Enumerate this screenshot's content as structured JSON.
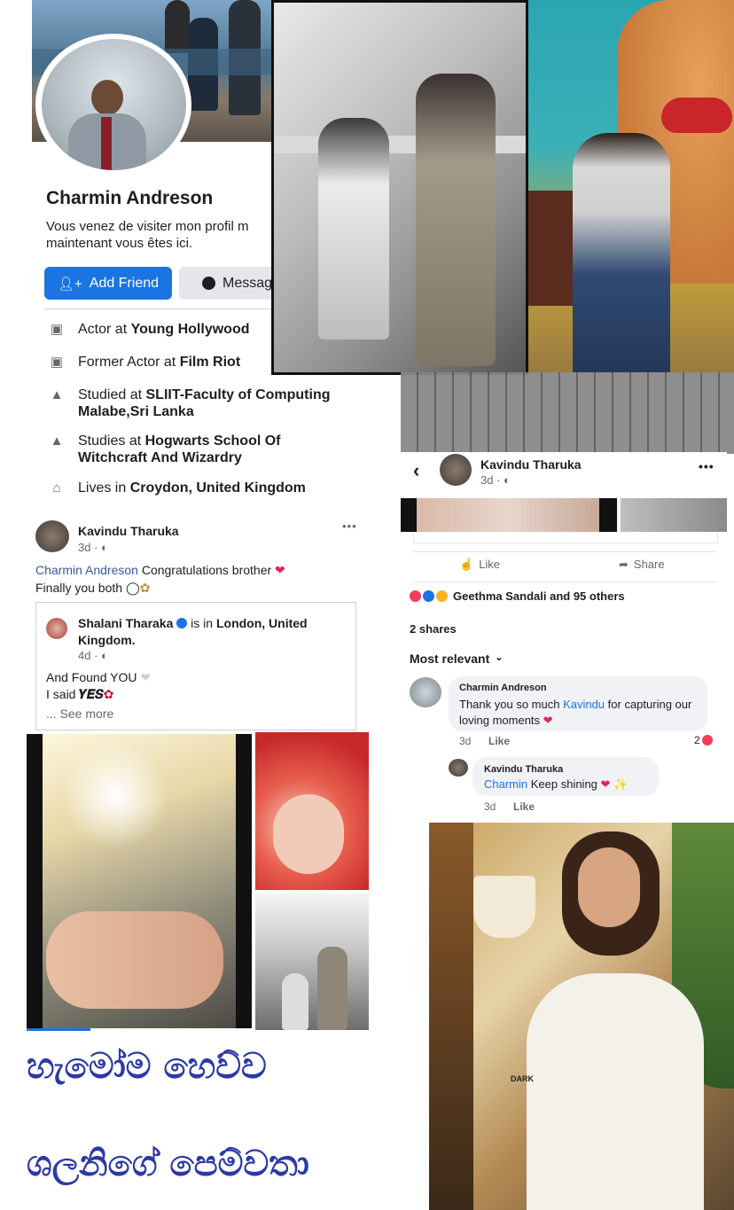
{
  "profile": {
    "name": "Charmin Andreson",
    "bio": "Vous venez de visiter mon profil m maintenant vous êtes ici.",
    "add_friend_label": "Add Friend",
    "message_label": "Messag",
    "info": [
      {
        "icon": "briefcase-icon",
        "prefix": "Actor at ",
        "bold": "Young Hollywood"
      },
      {
        "icon": "briefcase-icon",
        "prefix": "Former Actor at ",
        "bold": "Film Riot"
      },
      {
        "icon": "graduation-cap-icon",
        "prefix": "Studied at ",
        "bold": "SLIIT-Faculty of Computing Malabe,Sri Lanka"
      },
      {
        "icon": "graduation-cap-icon",
        "prefix": "Studies at ",
        "bold": "Hogwarts School Of Witchcraft And Wizardry"
      },
      {
        "icon": "home-icon",
        "prefix": "Lives in ",
        "bold": "Croydon, United Kingdom"
      }
    ]
  },
  "left_post": {
    "author": "Kavindu Tharuka",
    "time": "3d · ",
    "mention": "Charmin Andreson",
    "text1": " Congratulations brother ",
    "text2": "Finally you both ",
    "more_icon": "•••",
    "shared": {
      "author": "Shalani Tharaka",
      "is_in": " is in ",
      "location": "London, United Kingdom.",
      "time": "4d · ",
      "line1": "And Found YOU ",
      "line2": "I said ",
      "yes": "𝒀𝑬𝑺",
      "see_more": "... See more"
    }
  },
  "right_post": {
    "author": "Kavindu Tharuka",
    "time": "3d · ",
    "like_label": "Like",
    "share_label": "Share",
    "reactions_text": "Geethma Sandali and 95 others",
    "shares": "2 shares",
    "sort_label": "Most relevant",
    "comments": [
      {
        "author": "Charmin Andreson",
        "text_a": "Thank you so much ",
        "mention": "Kavindu",
        "text_b": " for capturing our loving moments",
        "time": "3d",
        "like": "Like",
        "count": "2"
      },
      {
        "author": "Kavindu Tharuka",
        "mention": "Charmin",
        "text_b": " Keep shining",
        "time": "3d",
        "like": "Like"
      }
    ]
  },
  "caption": {
    "line1": "හැමෝම හෙව්ව",
    "line2": "ශලනිගේ පෙම්වතා"
  },
  "colors": {
    "facebook_blue": "#1b74e4",
    "link_blue": "#385898",
    "caption_blue": "#2b3aa6"
  }
}
